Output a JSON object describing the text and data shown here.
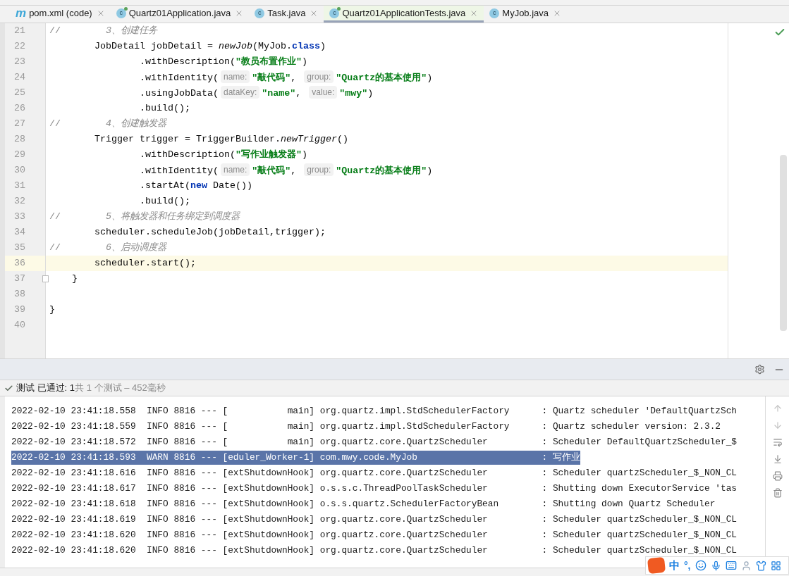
{
  "tabs": [
    {
      "label": "pom.xml (code)",
      "kind": "maven",
      "icon_letter": "m",
      "selected": false
    },
    {
      "label": "Quartz01Application.java",
      "kind": "runnable-class",
      "icon_letter": "c",
      "selected": false
    },
    {
      "label": "Task.java",
      "kind": "class",
      "icon_letter": "c",
      "selected": false
    },
    {
      "label": "Quartz01ApplicationTests.java",
      "kind": "runnable-class",
      "icon_letter": "c",
      "selected": true
    },
    {
      "label": "MyJob.java",
      "kind": "class",
      "icon_letter": "c",
      "selected": false
    }
  ],
  "code": {
    "lines": [
      {
        "number": "21",
        "highlighted": false,
        "tokens": [
          {
            "kind": "comment-marker",
            "text": "//"
          },
          {
            "kind": "comment",
            "text": "        3、创建任务"
          }
        ]
      },
      {
        "number": "22",
        "highlighted": false,
        "tokens": [
          {
            "kind": "plain",
            "text": "        JobDetail jobDetail = "
          },
          {
            "kind": "static-call",
            "text": "newJob"
          },
          {
            "kind": "plain",
            "text": "(MyJob."
          },
          {
            "kind": "keyword",
            "text": "class"
          },
          {
            "kind": "plain",
            "text": ")"
          }
        ]
      },
      {
        "number": "23",
        "highlighted": false,
        "tokens": [
          {
            "kind": "plain",
            "text": "                .withDescription("
          },
          {
            "kind": "string",
            "text": "\"教员布置作业\""
          },
          {
            "kind": "plain",
            "text": ")"
          }
        ]
      },
      {
        "number": "24",
        "highlighted": false,
        "tokens": [
          {
            "kind": "plain",
            "text": "                .withIdentity("
          },
          {
            "kind": "hint",
            "text": "name:"
          },
          {
            "kind": "string",
            "text": "\"敲代码\""
          },
          {
            "kind": "plain",
            "text": ", "
          },
          {
            "kind": "hint",
            "text": "group:"
          },
          {
            "kind": "string",
            "text": "\"Quartz的基本使用\""
          },
          {
            "kind": "plain",
            "text": ")"
          }
        ]
      },
      {
        "number": "25",
        "highlighted": false,
        "tokens": [
          {
            "kind": "plain",
            "text": "                .usingJobData("
          },
          {
            "kind": "hint",
            "text": "dataKey:"
          },
          {
            "kind": "string",
            "text": "\"name\""
          },
          {
            "kind": "plain",
            "text": ", "
          },
          {
            "kind": "hint",
            "text": "value:"
          },
          {
            "kind": "string",
            "text": "\"mwy\""
          },
          {
            "kind": "plain",
            "text": ")"
          }
        ]
      },
      {
        "number": "26",
        "highlighted": false,
        "tokens": [
          {
            "kind": "plain",
            "text": "                .build();"
          }
        ]
      },
      {
        "number": "27",
        "highlighted": false,
        "tokens": [
          {
            "kind": "comment-marker",
            "text": "//"
          },
          {
            "kind": "comment",
            "text": "        4、创建触发器"
          }
        ]
      },
      {
        "number": "28",
        "highlighted": false,
        "tokens": [
          {
            "kind": "plain",
            "text": "        Trigger trigger = TriggerBuilder."
          },
          {
            "kind": "static-call",
            "text": "newTrigger"
          },
          {
            "kind": "plain",
            "text": "()"
          }
        ]
      },
      {
        "number": "29",
        "highlighted": false,
        "tokens": [
          {
            "kind": "plain",
            "text": "                .withDescription("
          },
          {
            "kind": "string",
            "text": "\"写作业触发器\""
          },
          {
            "kind": "plain",
            "text": ")"
          }
        ]
      },
      {
        "number": "30",
        "highlighted": false,
        "tokens": [
          {
            "kind": "plain",
            "text": "                .withIdentity("
          },
          {
            "kind": "hint",
            "text": "name:"
          },
          {
            "kind": "string",
            "text": "\"敲代码\""
          },
          {
            "kind": "plain",
            "text": ", "
          },
          {
            "kind": "hint",
            "text": "group:"
          },
          {
            "kind": "string",
            "text": "\"Quartz的基本使用\""
          },
          {
            "kind": "plain",
            "text": ")"
          }
        ]
      },
      {
        "number": "31",
        "highlighted": false,
        "tokens": [
          {
            "kind": "plain",
            "text": "                .startAt("
          },
          {
            "kind": "keyword",
            "text": "new"
          },
          {
            "kind": "plain",
            "text": " Date())"
          }
        ]
      },
      {
        "number": "32",
        "highlighted": false,
        "tokens": [
          {
            "kind": "plain",
            "text": "                .build();"
          }
        ]
      },
      {
        "number": "33",
        "highlighted": false,
        "tokens": [
          {
            "kind": "comment-marker",
            "text": "//"
          },
          {
            "kind": "comment",
            "text": "        5、将触发器和任务绑定到调度器"
          }
        ]
      },
      {
        "number": "34",
        "highlighted": false,
        "tokens": [
          {
            "kind": "plain",
            "text": "        scheduler.scheduleJob(jobDetail,trigger);"
          }
        ]
      },
      {
        "number": "35",
        "highlighted": false,
        "tokens": [
          {
            "kind": "comment-marker",
            "text": "//"
          },
          {
            "kind": "comment",
            "text": "        6、启动调度器"
          }
        ]
      },
      {
        "number": "36",
        "highlighted": true,
        "tokens": [
          {
            "kind": "plain",
            "text": "        scheduler.start();"
          }
        ]
      },
      {
        "number": "37",
        "highlighted": false,
        "folded_end": true,
        "tokens": [
          {
            "kind": "plain",
            "text": "    }"
          }
        ]
      },
      {
        "number": "38",
        "highlighted": false
      },
      {
        "number": "39",
        "highlighted": false,
        "tokens": [
          {
            "kind": "plain",
            "text": "}"
          }
        ]
      },
      {
        "number": "40",
        "highlighted": false
      }
    ]
  },
  "test_status": {
    "passed": "测试 已通过: 1",
    "summary": "共 1 个测试 – 452毫秒"
  },
  "console": {
    "lines": [
      {
        "text": "2022-02-10 23:41:18.558  INFO 8816 --- [           main] org.quartz.impl.StdSchedulerFactory      : Quartz scheduler 'DefaultQuartzSch",
        "selected": false
      },
      {
        "text": "2022-02-10 23:41:18.559  INFO 8816 --- [           main] org.quartz.impl.StdSchedulerFactory      : Quartz scheduler version: 2.3.2",
        "selected": false
      },
      {
        "text": "2022-02-10 23:41:18.572  INFO 8816 --- [           main] org.quartz.core.QuartzScheduler          : Scheduler DefaultQuartzScheduler_$",
        "selected": false
      },
      {
        "text": "2022-02-10 23:41:18.593  WARN 8816 --- [eduler_Worker-1] com.mwy.code.MyJob                       : 写作业",
        "selected": true
      },
      {
        "text": "2022-02-10 23:41:18.616  INFO 8816 --- [extShutdownHook] org.quartz.core.QuartzScheduler          : Scheduler quartzScheduler_$_NON_CL",
        "selected": false
      },
      {
        "text": "2022-02-10 23:41:18.617  INFO 8816 --- [extShutdownHook] o.s.s.c.ThreadPoolTaskScheduler          : Shutting down ExecutorService 'tas",
        "selected": false
      },
      {
        "text": "2022-02-10 23:41:18.618  INFO 8816 --- [extShutdownHook] o.s.s.quartz.SchedulerFactoryBean        : Shutting down Quartz Scheduler",
        "selected": false
      },
      {
        "text": "2022-02-10 23:41:18.619  INFO 8816 --- [extShutdownHook] org.quartz.core.QuartzScheduler          : Scheduler quartzScheduler_$_NON_CL",
        "selected": false
      },
      {
        "text": "2022-02-10 23:41:18.620  INFO 8816 --- [extShutdownHook] org.quartz.core.QuartzScheduler          : Scheduler quartzScheduler_$_NON_CL",
        "selected": false
      },
      {
        "text": "2022-02-10 23:41:18.620  INFO 8816 --- [extShutdownHook] org.quartz.core.QuartzScheduler          : Scheduler quartzScheduler_$_NON_CL",
        "selected": false
      }
    ]
  },
  "ime": {
    "language": "中",
    "punctuation": "°,"
  }
}
